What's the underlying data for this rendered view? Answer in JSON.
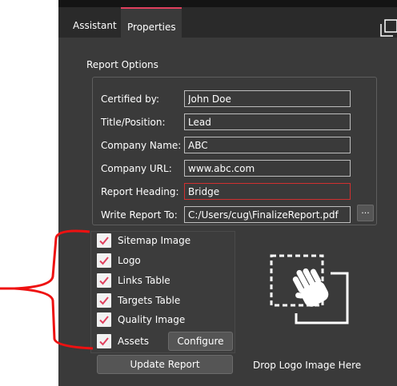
{
  "tabs": [
    {
      "label": "Assistant",
      "active": false
    },
    {
      "label": "Properties",
      "active": true
    }
  ],
  "report_options": {
    "title": "Report Options",
    "fields": [
      {
        "label": "Certified by:",
        "value": "John Doe"
      },
      {
        "label": "Title/Position:",
        "value": "Lead"
      },
      {
        "label": "Company Name:",
        "value": "ABC"
      },
      {
        "label": "Company URL:",
        "value": "www.abc.com"
      },
      {
        "label": "Report Heading:",
        "value": "Bridge"
      },
      {
        "label": "Write Report To:",
        "value": "C:/Users/cug\\FinalizeReport.pdf"
      }
    ],
    "browse_label": "..."
  },
  "checkboxes": [
    {
      "label": "Sitemap Image",
      "checked": true
    },
    {
      "label": "Logo",
      "checked": true
    },
    {
      "label": "Links Table",
      "checked": true
    },
    {
      "label": "Targets Table",
      "checked": true
    },
    {
      "label": "Quality Image",
      "checked": true
    },
    {
      "label": "Assets",
      "checked": true
    }
  ],
  "configure_label": "Configure",
  "update_label": "Update Report",
  "drop_zone": {
    "label": "Drop Logo Image Here",
    "icon": "drag-hand-icon"
  },
  "icons": {
    "undock": "undock-icon",
    "check": "checkmark-icon"
  },
  "colors": {
    "panel_bg": "#3a3a3a",
    "tab_bar_bg": "#2a2a2a",
    "active_tab_accent": "#e0405e",
    "check_mark": "#e0405e",
    "highlighted_field_border": "#d13030",
    "annotation_bracket": "#ee1111"
  }
}
